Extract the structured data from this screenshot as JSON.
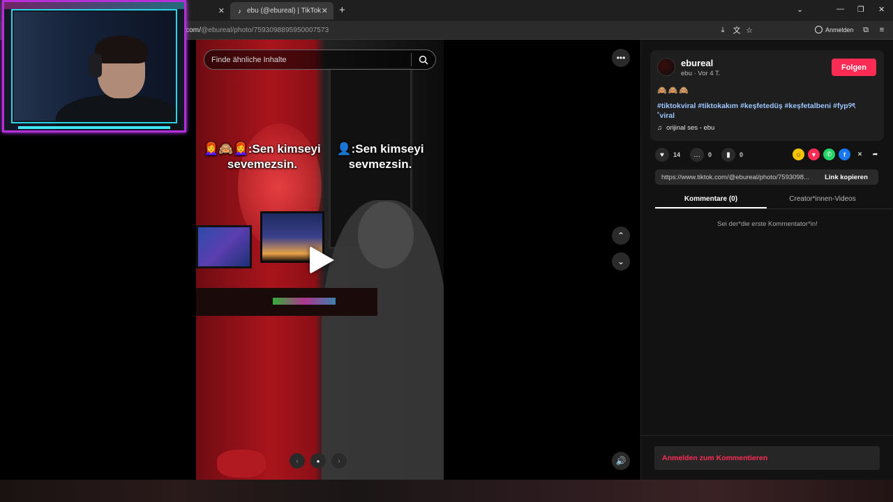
{
  "browser": {
    "tabs": [
      {
        "title": ""
      },
      {
        "title": "ebu (@ebureal) | TikTok"
      }
    ],
    "url_prefix": "com/",
    "url_path": "@ebureal/photo/7593098895950007573",
    "signin_label": "Anmelden"
  },
  "video": {
    "search_placeholder": "Finde ähnliche Inhalte",
    "caption_left": "👩‍🦰🙈👩‍🦰:Sen kimseyi sevemezsin.",
    "caption_right": "👤:Sen kimseyi sevmezsin."
  },
  "post": {
    "username": "ebureal",
    "meta": "ebu · Vor 4 T.",
    "follow_label": "Folgen",
    "emojis": "🙈🙈🙈",
    "hashtags": "#tiktokviral #tiktokakım #keşfetedüş #keşfetalbeni #fyp୨ৎ ˚viral",
    "music": "orijinal ses - ebu",
    "likes": "14",
    "comments": "0",
    "saves": "0",
    "link": "https://www.tiktok.com/@ebureal/photo/7593098...",
    "copy_label": "Link kopieren",
    "tab_comments": "Kommentare (0)",
    "tab_creator": "Creator*innen-Videos",
    "empty_comments": "Sei der*die erste Kommentator*in!",
    "login_comment": "Anmelden zum Kommentieren"
  },
  "colors": {
    "accent": "#fe2c55",
    "panel": "#121212",
    "hashtag": "#9ec7ff"
  }
}
